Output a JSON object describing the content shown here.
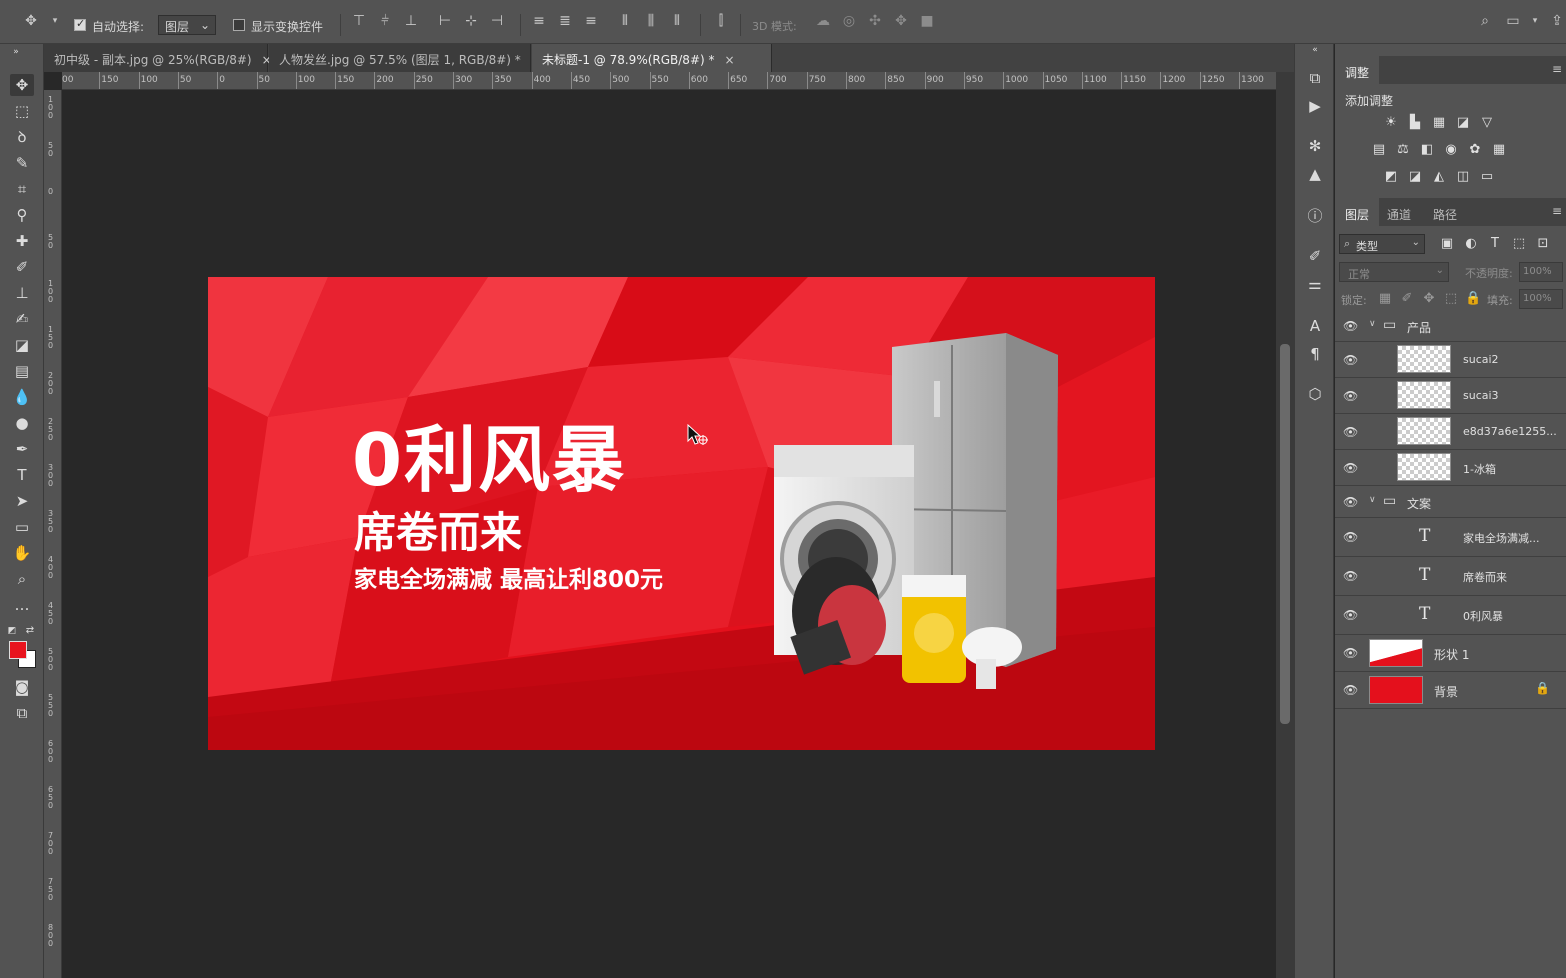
{
  "options_bar": {
    "auto_select_label": "自动选择:",
    "auto_select_target": "图层",
    "show_transform_label": "显示变换控件",
    "mode_3d_label": "3D 模式:"
  },
  "tabs": [
    {
      "label": "初中级 - 副本.jpg @ 25%(RGB/8#)",
      "close": "×"
    },
    {
      "label": "人物发丝.jpg @ 57.5% (图层 1, RGB/8#) *",
      "close": "×"
    },
    {
      "label": "未标题-1 @ 78.9%(RGB/8#) *",
      "close": "×"
    }
  ],
  "ruler_h": [
    "00",
    "150",
    "100",
    "50",
    "0",
    "50",
    "100",
    "150",
    "200",
    "250",
    "300",
    "350",
    "400",
    "450",
    "500",
    "550",
    "600",
    "650",
    "700",
    "750",
    "800",
    "850",
    "900",
    "950",
    "1000",
    "1050",
    "1100",
    "1150",
    "1200",
    "1250",
    "1300"
  ],
  "ruler_v": [
    "1 0 0",
    "5 0",
    "0",
    "5 0",
    "1 0 0",
    "1 5 0",
    "2 0 0",
    "2 5 0",
    "3 0 0",
    "3 5 0",
    "4 0 0",
    "4 5 0",
    "5 0 0",
    "5 5 0",
    "6 0 0",
    "6 5 0",
    "7 0 0",
    "7 5 0",
    "8 0 0"
  ],
  "artwork": {
    "headline": "0利风暴",
    "subhead": "席卷而来",
    "tagline": "家电全场满减 最高让利800元"
  },
  "adjustments": {
    "tab_label": "调整",
    "add_label": "添加调整"
  },
  "layers_panel": {
    "tabs": [
      "图层",
      "通道",
      "路径"
    ],
    "filter_label": "类型",
    "blend_mode": "正常",
    "opacity_label": "不透明度:",
    "opacity_value": "100%",
    "lock_label": "锁定:",
    "fill_label": "填充:",
    "fill_value": "100%",
    "layers": [
      {
        "name": "产品",
        "kind": "group"
      },
      {
        "name": "sucai2",
        "kind": "smart"
      },
      {
        "name": "sucai3",
        "kind": "smart"
      },
      {
        "name": "e8d37a6e1255...",
        "kind": "smart"
      },
      {
        "name": "1-冰箱",
        "kind": "smart"
      },
      {
        "name": "文案",
        "kind": "group"
      },
      {
        "name": "家电全场满减...",
        "kind": "text"
      },
      {
        "name": "席卷而来",
        "kind": "text"
      },
      {
        "name": "0利风暴",
        "kind": "text"
      },
      {
        "name": "形状 1",
        "kind": "shape"
      },
      {
        "name": "背景",
        "kind": "background"
      }
    ]
  },
  "colors": {
    "foreground": "#e8141e",
    "background": "#ffffff",
    "banner_red": "#e4101c"
  }
}
